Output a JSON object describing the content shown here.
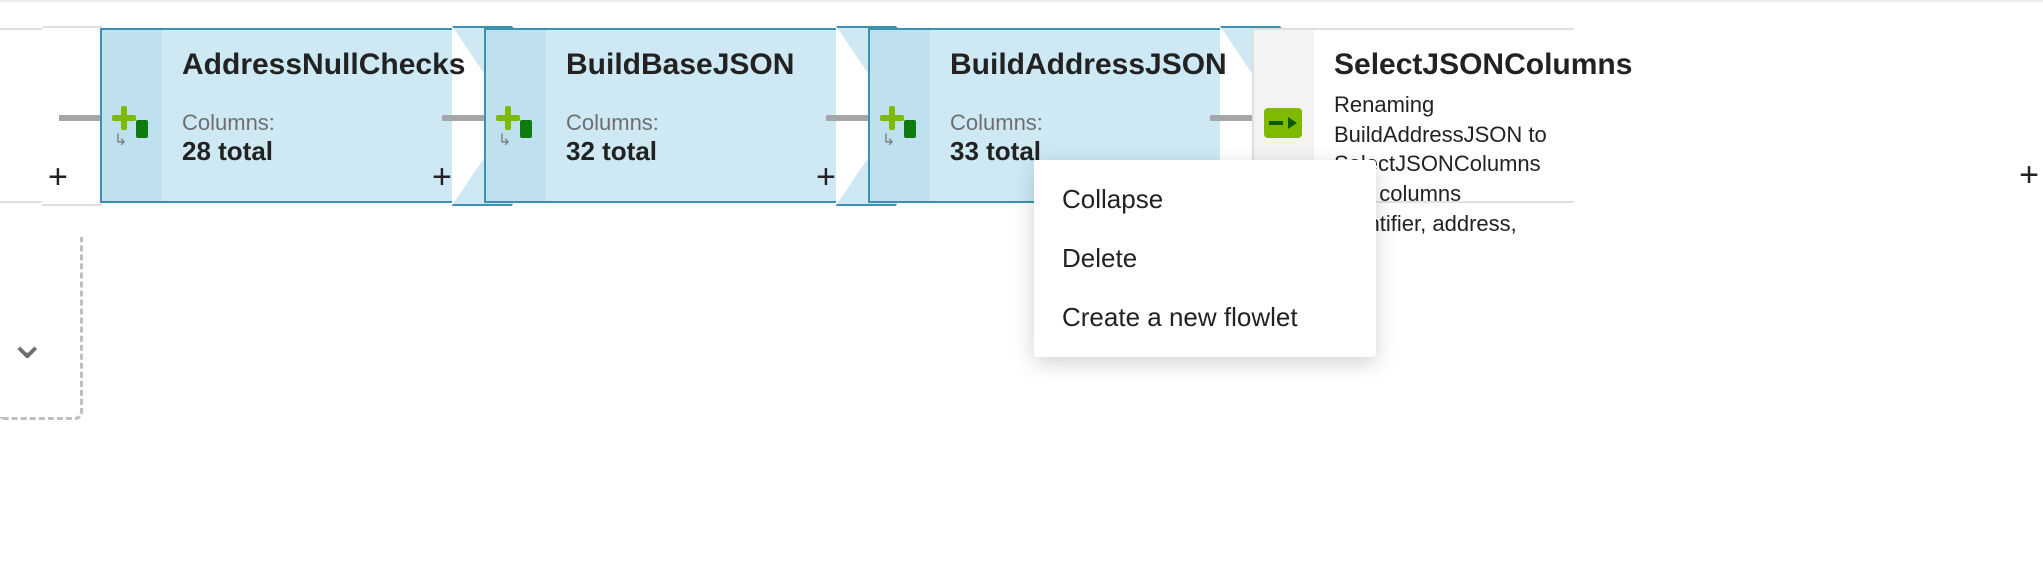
{
  "nodes": {
    "addressNull": {
      "title": "AddressNullChecks",
      "columns_label": "Columns:",
      "columns_value": "28 total"
    },
    "buildBase": {
      "title": "BuildBaseJSON",
      "columns_label": "Columns:",
      "columns_value": "32 total"
    },
    "buildAddress": {
      "title": "BuildAddressJSON",
      "columns_label": "Columns:",
      "columns_value": "33 total"
    },
    "selectCols": {
      "title": "SelectJSONColumns",
      "desc": "Renaming BuildAddressJSON to SelectJSONColumns with columns 'identifier, address,"
    }
  },
  "context_menu": {
    "collapse": "Collapse",
    "delete": "Delete",
    "new_flowlet": "Create a new flowlet"
  },
  "glyphs": {
    "plus": "+",
    "chevron_down": "⌄",
    "derive_arrow": "↳",
    "right_plus": "+"
  }
}
